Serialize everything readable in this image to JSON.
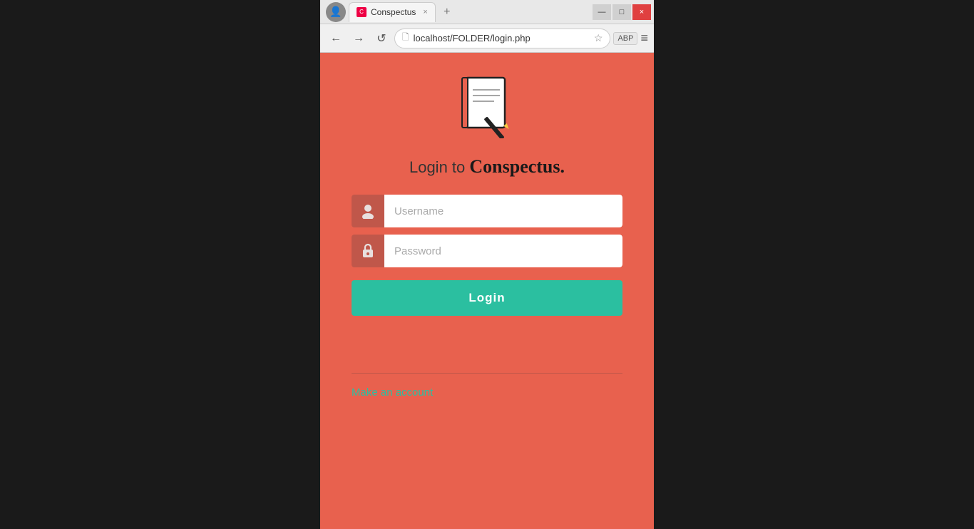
{
  "browser": {
    "tab_title": "Conspectus",
    "tab_close": "×",
    "new_tab_label": "+",
    "url": "localhost/FOLDER/login.php",
    "back_icon": "←",
    "forward_icon": "→",
    "reload_icon": "↺",
    "bookmark_icon": "☆",
    "abp_label": "ABP",
    "menu_icon": "≡",
    "user_icon": "👤",
    "minimize_icon": "—",
    "maximize_icon": "□",
    "close_icon": "×"
  },
  "page": {
    "login_prefix": "Login to ",
    "app_name": "Conspectus.",
    "username_placeholder": "Username",
    "password_placeholder": "Password",
    "login_button_label": "Login",
    "make_account_label": "Make an account"
  },
  "colors": {
    "background": "#e8614e",
    "teal": "#2bbfa0",
    "input_bg": "#c0574a"
  }
}
